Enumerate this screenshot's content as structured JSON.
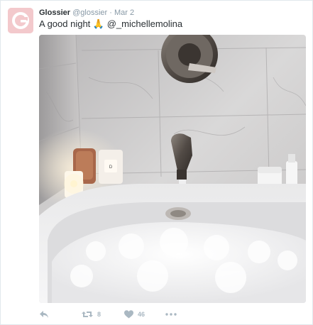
{
  "tweet": {
    "name": "Glossier",
    "handle": "@glossier",
    "separator": "·",
    "date": "Mar 2",
    "text": "A good night",
    "emoji": "🙏",
    "mention": "@_michellemolina",
    "avatar_icon": "glossier-g-logo",
    "image_description_icon": "bathtub-photo",
    "counts": {
      "retweets": "8",
      "likes": "46"
    }
  },
  "colors": {
    "avatar_bg": "#f3c9cc",
    "text": "#292f33",
    "muted": "#8899a6",
    "action": "#aab8c2"
  }
}
